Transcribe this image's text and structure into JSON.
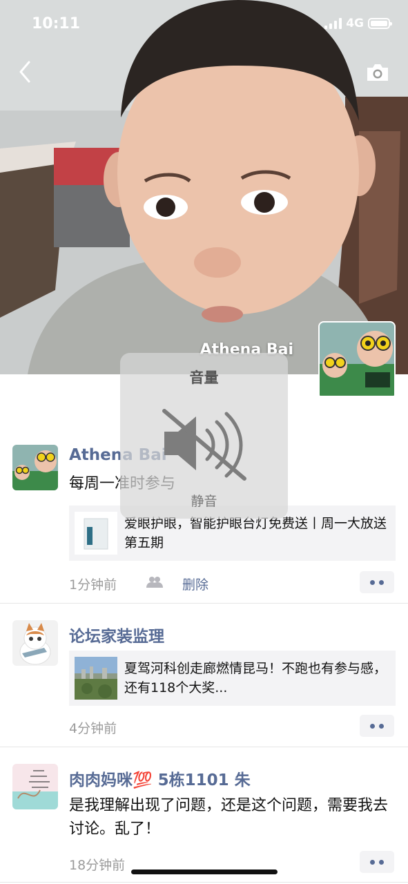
{
  "status_bar": {
    "time": "10:11",
    "network": "4G",
    "icons": [
      "signal-icon",
      "battery-icon"
    ]
  },
  "header": {
    "back_icon": "chevron-left-icon",
    "camera_icon": "camera-icon"
  },
  "profile": {
    "name": "Athena Bai"
  },
  "volume_hud": {
    "title": "音量",
    "state": "静音",
    "icon": "speaker-muted-icon"
  },
  "posts": [
    {
      "author": "Athena Bai",
      "text": "每周一准时参与",
      "share": {
        "title": "爱眼护眼，智能护眼台灯免费送丨周一大放送第五期"
      },
      "time": "1分钟前",
      "privacy_icon": "people-icon",
      "delete_label": "删除",
      "more_icon": "more-dots-icon"
    },
    {
      "author": "论坛家装监理",
      "share": {
        "title": "夏驾河科创走廊燃情昆马！不跑也有参与感，还有118个大奖..."
      },
      "time": "4分钟前",
      "more_icon": "more-dots-icon"
    },
    {
      "author": "肉肉妈咪💯 5栋1101 朱",
      "text": "是我理解出现了问题，还是这个问题，需要我去讨论。乱了！",
      "time": "18分钟前",
      "more_icon": "more-dots-icon"
    }
  ],
  "colors": {
    "link": "#576b95",
    "time": "#9b9b9b",
    "card_bg": "#f3f3f5"
  }
}
